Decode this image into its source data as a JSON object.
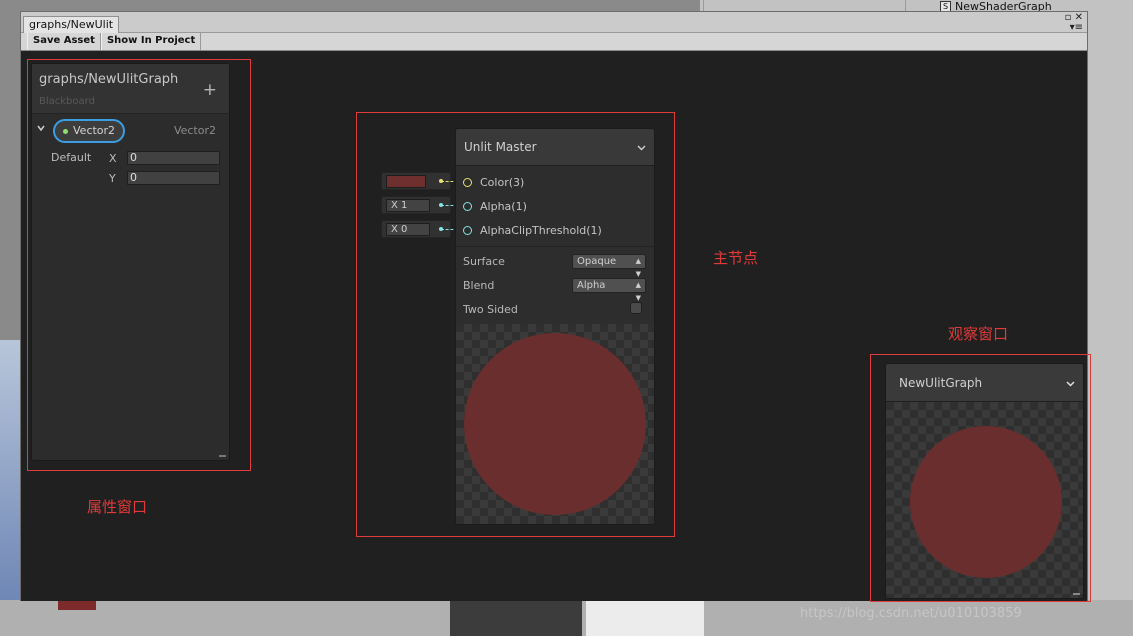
{
  "background": {
    "project_item": "NewShaderGraph",
    "project_item_icon": "S",
    "watermark": "https://blog.csdn.net/u010103859"
  },
  "window": {
    "tab_title": "graphs/NewUlit",
    "toolbar": {
      "save_asset": "Save Asset",
      "show_in_project": "Show In Project"
    }
  },
  "blackboard": {
    "title": "graphs/NewUlitGraph",
    "subtitle": "Blackboard",
    "add": "+",
    "property": {
      "name": "Vector2",
      "type": "Vector2",
      "default_label": "Default",
      "x_label": "X",
      "x_value": "0",
      "y_label": "Y",
      "y_value": "0"
    }
  },
  "master_node": {
    "title": "Unlit Master",
    "ports": [
      {
        "label": "Color(3)",
        "input": "",
        "color": "#e8e370"
      },
      {
        "label": "Alpha(1)",
        "input": "X  1",
        "color": "#84e4e7"
      },
      {
        "label": "AlphaClipThreshold(1)",
        "input": "X  0",
        "color": "#84e4e7"
      }
    ],
    "color_swatch": "#6f2f2f",
    "surface_label": "Surface",
    "surface_value": "Opaque",
    "blend_label": "Blend",
    "blend_value": "Alpha",
    "two_sided_label": "Two Sided",
    "two_sided_checked": false,
    "preview_color": "#6b2e2e"
  },
  "main_preview": {
    "title": "NewUlitGraph",
    "preview_color": "#6b2e2e"
  },
  "annotations": {
    "color": "#e03a3a",
    "property_window": "属性窗口",
    "master_node": "主节点",
    "observation_window": "观察窗口"
  }
}
